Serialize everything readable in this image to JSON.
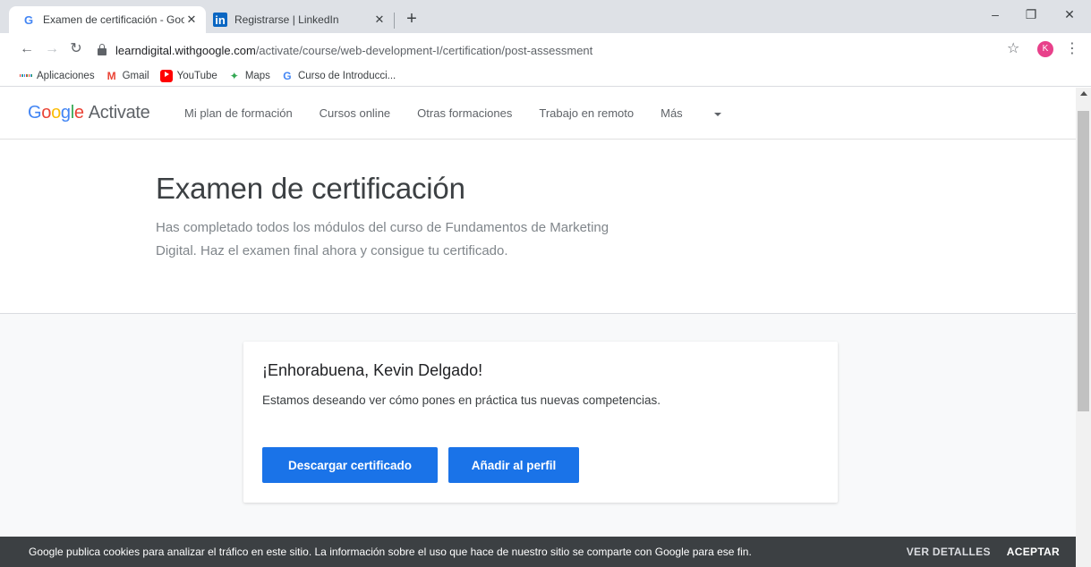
{
  "browser": {
    "tabs": [
      {
        "title": "Examen de certificación - Google",
        "favicon": "google-g-icon",
        "active": true
      },
      {
        "title": "Registrarse | LinkedIn",
        "favicon": "linkedin-icon",
        "active": false
      }
    ],
    "new_tab": "+",
    "window_controls": {
      "minimize": "–",
      "maximize": "❐",
      "close": "✕"
    },
    "url_host": "learndigital.withgoogle.com",
    "url_path": "/activate/course/web-development-I/certification/post-assessment",
    "profile_initial": "K",
    "bookmarks": [
      {
        "label": "Aplicaciones",
        "icon": "apps-grid-icon"
      },
      {
        "label": "Gmail",
        "icon": "gmail-icon",
        "glyph": "M"
      },
      {
        "label": "YouTube",
        "icon": "youtube-icon"
      },
      {
        "label": "Maps",
        "icon": "maps-icon",
        "glyph": "✦"
      },
      {
        "label": "Curso de Introducci...",
        "icon": "google-g-icon",
        "glyph": "G"
      }
    ]
  },
  "site": {
    "logo": {
      "g": "G",
      "o1": "o",
      "o2": "o",
      "g2": "g",
      "l": "l",
      "e": "e",
      "product": "Activate"
    },
    "nav": [
      "Mi plan de formación",
      "Cursos online",
      "Otras formaciones",
      "Trabajo en remoto",
      "Más"
    ]
  },
  "hero": {
    "title": "Examen de certificación",
    "subtitle": "Has completado todos los módulos del curso de Fundamentos de Marketing Digital. Haz el examen final ahora y consigue tu certificado."
  },
  "card": {
    "heading": "¡Enhorabuena, Kevin Delgado!",
    "text": "Estamos deseando ver cómo pones en práctica tus nuevas competencias.",
    "download_label": "Descargar certificado",
    "add_label": "Añadir al perfil"
  },
  "cookie": {
    "message": "Google publica cookies para analizar el tráfico en este sitio. La información sobre el uso que hace de nuestro sitio se comparte con Google para ese fin.",
    "details_label": "VER DETALLES",
    "accept_label": "ACEPTAR"
  },
  "colors": {
    "accent": "#1a73e8",
    "cookie_bg": "#3c4043",
    "avatar": "#e8408a"
  }
}
